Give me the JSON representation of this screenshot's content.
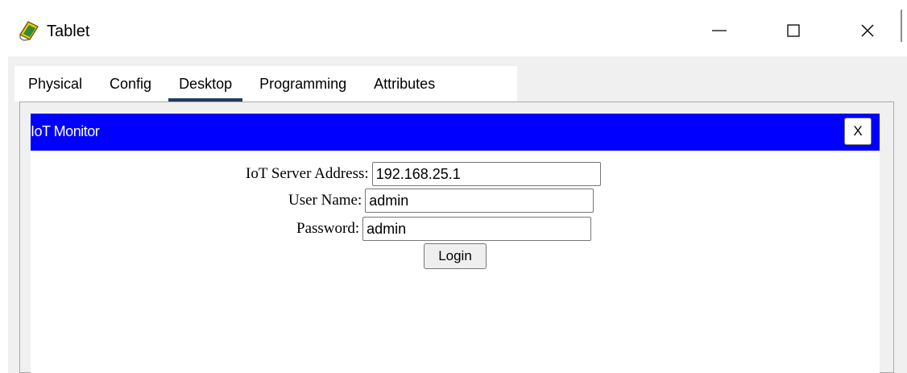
{
  "window": {
    "title": "Tablet",
    "icon": "tablet-app-icon",
    "controls": {
      "minimize_icon": "minimize-icon",
      "maximize_icon": "maximize-icon",
      "close_icon": "close-icon"
    }
  },
  "tabs": [
    {
      "label": "Physical",
      "active": false
    },
    {
      "label": "Config",
      "active": false
    },
    {
      "label": "Desktop",
      "active": true
    },
    {
      "label": "Programming",
      "active": false
    },
    {
      "label": "Attributes",
      "active": false
    }
  ],
  "iot_monitor": {
    "title": "IoT Monitor",
    "close_label": "X",
    "header_color": "#0000ff",
    "form": {
      "server_label": "IoT Server Address:",
      "server_value": "192.168.25.1",
      "username_label": "User Name:",
      "username_value": "admin",
      "password_label": "Password:",
      "password_value": "admin",
      "login_label": "Login"
    }
  }
}
